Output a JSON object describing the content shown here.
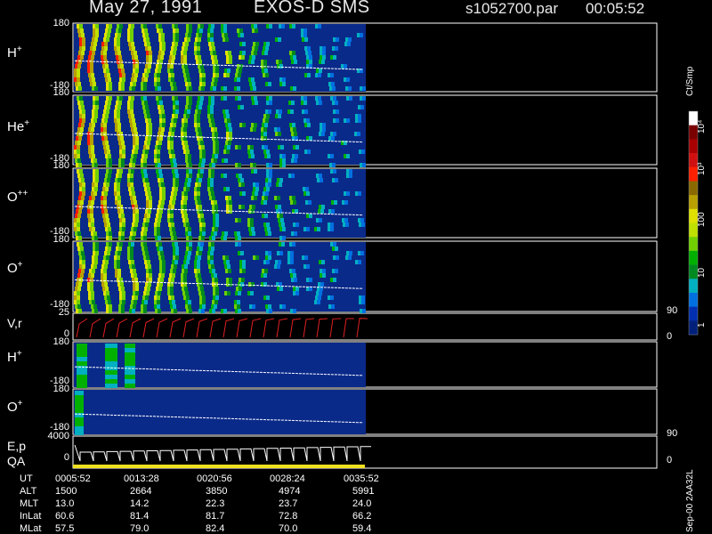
{
  "header": {
    "date": "May 27, 1991",
    "instrument": "EXOS-D SMS",
    "file": "s1052700.par",
    "time": "00:05:52"
  },
  "panels": [
    {
      "label": "H",
      "sup": "+",
      "ymax": "180",
      "ymin": "-180"
    },
    {
      "label": "He",
      "sup": "+",
      "ymax": "180",
      "ymin": "-180"
    },
    {
      "label": "O",
      "sup": "++",
      "ymax": "180",
      "ymin": "-180"
    },
    {
      "label": "O",
      "sup": "+",
      "ymax": "180",
      "ymin": "-180"
    },
    {
      "label": "V,r",
      "sup": "",
      "ymax": "25",
      "ymin": "0",
      "rmax": "90",
      "rmin": "0"
    },
    {
      "label": "H",
      "sup": "+",
      "ymax": "180",
      "ymin": "-180"
    },
    {
      "label": "O",
      "sup": "+",
      "ymax": "180",
      "ymin": "-180"
    },
    {
      "label": "E,p",
      "sup": "",
      "label2": "QA",
      "ymax": "4000",
      "ymin": "0",
      "rmax": "90",
      "rmin": "0"
    }
  ],
  "colorbar": {
    "unit": "Ct/Smp",
    "ticks": [
      "10⁴",
      "10³",
      "100",
      "10",
      "1"
    ],
    "colors": [
      "#ffffff",
      "#7a0000",
      "#a80000",
      "#d01010",
      "#ff2000",
      "#8a6a00",
      "#b8a000",
      "#e0e000",
      "#c0e000",
      "#70d000",
      "#00b000",
      "#008a20",
      "#00b0c0",
      "#0070e0",
      "#0030b0",
      "#00207a"
    ]
  },
  "footer_side": "Sep-00  2AA32L",
  "chart_data": {
    "type": "heatmap",
    "title": "May 27, 1991   EXOS-D SMS",
    "x_label": "UT",
    "ephemeris": {
      "labels": [
        "UT",
        "ALT",
        "MLT",
        "InLat",
        "MLat"
      ],
      "columns": [
        [
          "0005:52",
          "1500",
          "13.0",
          "60.6",
          "57.5"
        ],
        [
          "0013:28",
          "2664",
          "14.2",
          "81.4",
          "79.0"
        ],
        [
          "0020:56",
          "3850",
          "22.3",
          "81.7",
          "82.4"
        ],
        [
          "0028:24",
          "4974",
          "23.7",
          "72.8",
          "70.0"
        ],
        [
          "0035:52",
          "5991",
          "24.0",
          "66.2",
          "59.4"
        ]
      ]
    },
    "colorbar_ticks": [
      "10⁴",
      "10³",
      "100",
      "10",
      "1"
    ]
  }
}
